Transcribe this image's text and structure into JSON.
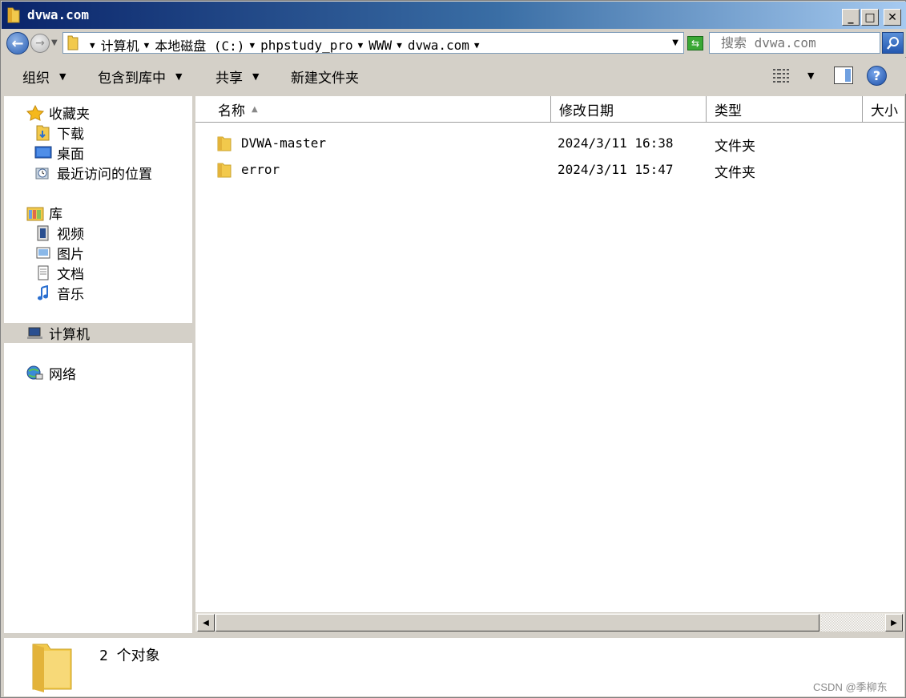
{
  "window": {
    "title": "dvwa.com"
  },
  "titlebar_buttons": {
    "minimize": "_",
    "maximize": "□",
    "close": "✕"
  },
  "address": {
    "crumbs": [
      "计算机",
      "本地磁盘 (C:)",
      "phpstudy_pro",
      "WWW",
      "dvwa.com"
    ],
    "search_placeholder": "搜索 dvwa.com"
  },
  "toolbar": {
    "organize": "组织",
    "include_library": "包含到库中",
    "share": "共享",
    "new_folder": "新建文件夹"
  },
  "nav": {
    "favorites": "收藏夹",
    "downloads": "下载",
    "desktop": "桌面",
    "recent": "最近访问的位置",
    "libraries": "库",
    "videos": "视频",
    "pictures": "图片",
    "documents": "文档",
    "music": "音乐",
    "computer": "计算机",
    "network": "网络"
  },
  "columns": {
    "name": "名称",
    "date": "修改日期",
    "type": "类型",
    "size": "大小"
  },
  "files": [
    {
      "name": "DVWA-master",
      "date": "2024/3/11 16:38",
      "type": "文件夹"
    },
    {
      "name": "error",
      "date": "2024/3/11 15:47",
      "type": "文件夹"
    }
  ],
  "status": {
    "count": "2 个对象"
  },
  "watermark": "CSDN @季柳东",
  "colors": {
    "title_start": "#0a246a",
    "title_end": "#a6caf0",
    "folder": "#f2c94c",
    "chrome": "#d4d0c8"
  }
}
